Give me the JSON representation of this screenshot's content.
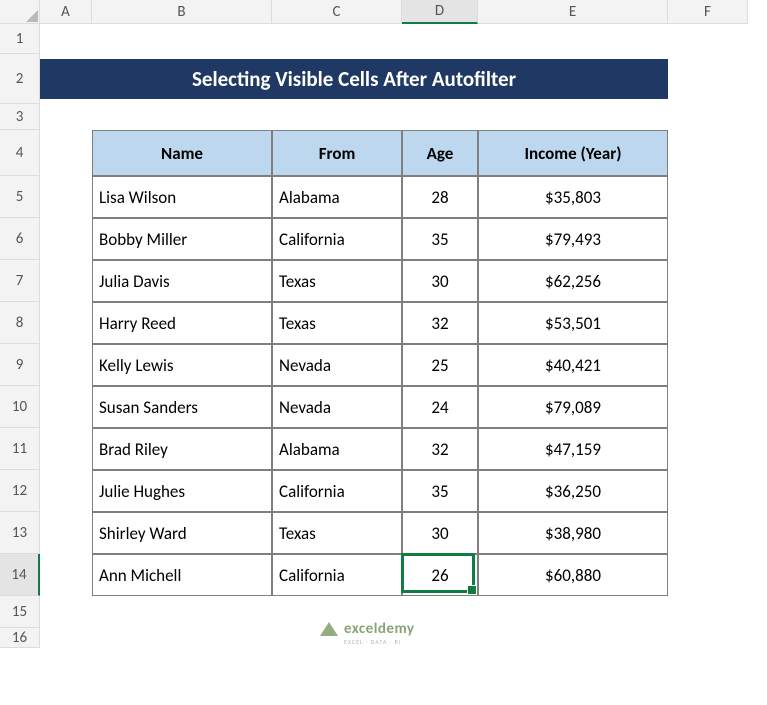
{
  "columns": [
    "A",
    "B",
    "C",
    "D",
    "E",
    "F"
  ],
  "rows": [
    "1",
    "2",
    "3",
    "4",
    "5",
    "6",
    "7",
    "8",
    "9",
    "10",
    "11",
    "12",
    "13",
    "14",
    "15",
    "16"
  ],
  "title": "Selecting Visible Cells After Autofilter",
  "headers": {
    "name": "Name",
    "from": "From",
    "age": "Age",
    "income": "Income (Year)"
  },
  "data": [
    {
      "name": "Lisa Wilson",
      "from": "Alabama",
      "age": "28",
      "income": "$35,803"
    },
    {
      "name": "Bobby Miller",
      "from": "California",
      "age": "35",
      "income": "$79,493"
    },
    {
      "name": "Julia Davis",
      "from": "Texas",
      "age": "30",
      "income": "$62,256"
    },
    {
      "name": "Harry Reed",
      "from": "Texas",
      "age": "32",
      "income": "$53,501"
    },
    {
      "name": "Kelly Lewis",
      "from": "Nevada",
      "age": "25",
      "income": "$40,421"
    },
    {
      "name": "Susan Sanders",
      "from": "Nevada",
      "age": "24",
      "income": "$79,089"
    },
    {
      "name": "Brad Riley",
      "from": "Alabama",
      "age": "32",
      "income": "$47,159"
    },
    {
      "name": "Julie Hughes",
      "from": "California",
      "age": "35",
      "income": "$36,250"
    },
    {
      "name": "Shirley Ward",
      "from": "Texas",
      "age": "30",
      "income": "$38,980"
    },
    {
      "name": "Ann Michell",
      "from": "California",
      "age": "26",
      "income": "$60,880"
    }
  ],
  "active_cell": {
    "col": "D",
    "row": "14"
  },
  "watermark": {
    "name": "exceldemy",
    "tag": "EXCEL · DATA · BI"
  }
}
